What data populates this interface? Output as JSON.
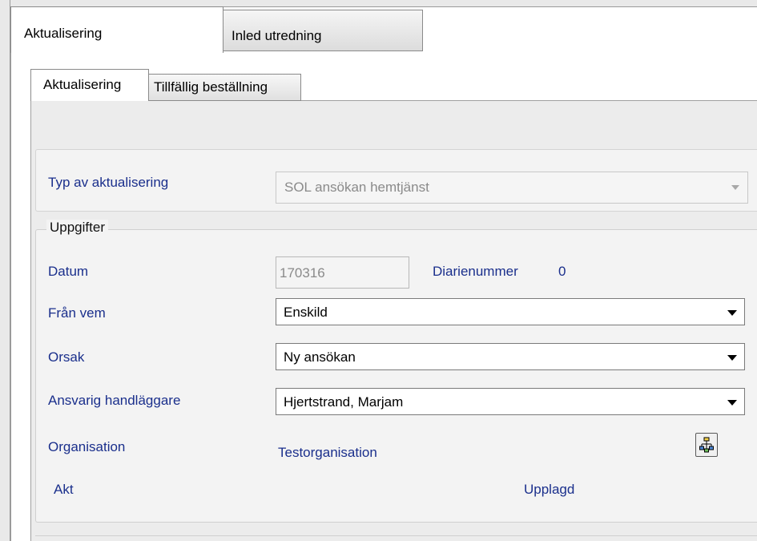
{
  "tabs": {
    "outer": [
      {
        "label": "Aktualisering",
        "active": true
      },
      {
        "label": "Inled utredning",
        "active": false
      }
    ],
    "inner": [
      {
        "label": "Aktualisering",
        "active": true
      },
      {
        "label": "Tillfällig beställning",
        "active": false
      }
    ]
  },
  "typ": {
    "label": "Typ av aktualisering",
    "value": "SOL ansökan hemtjänst"
  },
  "uppgifter": {
    "title": "Uppgifter",
    "datum_label": "Datum",
    "datum_value": "170316",
    "diarienummer_label": "Diarienummer",
    "diarienummer_value": "0",
    "fran_vem_label": "Från vem",
    "fran_vem_value": "Enskild",
    "orsak_label": "Orsak",
    "orsak_value": "Ny ansökan",
    "ansvarig_label": "Ansvarig handläggare",
    "ansvarig_value": "Hjertstrand, Marjam",
    "organisation_label": "Organisation",
    "organisation_value": "Testorganisation",
    "organisation_button_icon": "org-chart-icon",
    "akt_label": "Akt",
    "akt_status": "Upplagd"
  },
  "colors": {
    "label_blue": "#1a2f8c",
    "panel_bg": "#f3f3f3",
    "disabled_text": "#8a8a8a"
  }
}
